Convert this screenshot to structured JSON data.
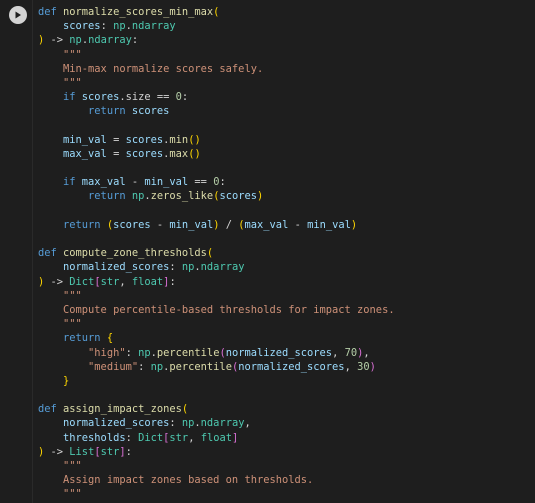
{
  "cell": {
    "run_icon": "play-icon",
    "lines": [
      [
        {
          "t": "def ",
          "c": "kw"
        },
        {
          "t": "normalize_scores_min_max",
          "c": "fn"
        },
        {
          "t": "(",
          "c": "bracket"
        }
      ],
      [
        {
          "t": "    scores",
          "c": "param"
        },
        {
          "t": ": ",
          "c": "op"
        },
        {
          "t": "np",
          "c": "type"
        },
        {
          "t": ".",
          "c": "op"
        },
        {
          "t": "ndarray",
          "c": "type"
        }
      ],
      [
        {
          "t": ")",
          "c": "bracket"
        },
        {
          "t": " -> ",
          "c": "op"
        },
        {
          "t": "np",
          "c": "type"
        },
        {
          "t": ".",
          "c": "op"
        },
        {
          "t": "ndarray",
          "c": "type"
        },
        {
          "t": ":",
          "c": "op"
        }
      ],
      [
        {
          "t": "    \"\"\"",
          "c": "str"
        }
      ],
      [
        {
          "t": "    Min-max normalize scores safely.",
          "c": "str"
        }
      ],
      [
        {
          "t": "    \"\"\"",
          "c": "str"
        }
      ],
      [
        {
          "t": "    if ",
          "c": "kw"
        },
        {
          "t": "scores",
          "c": "param"
        },
        {
          "t": ".size == ",
          "c": "op"
        },
        {
          "t": "0",
          "c": "num"
        },
        {
          "t": ":",
          "c": "op"
        }
      ],
      [
        {
          "t": "        return ",
          "c": "kw"
        },
        {
          "t": "scores",
          "c": "param"
        }
      ],
      [
        {
          "t": "",
          "c": "op"
        }
      ],
      [
        {
          "t": "    min_val",
          "c": "param"
        },
        {
          "t": " = ",
          "c": "op"
        },
        {
          "t": "scores",
          "c": "param"
        },
        {
          "t": ".",
          "c": "op"
        },
        {
          "t": "min",
          "c": "fn"
        },
        {
          "t": "()",
          "c": "bracket"
        }
      ],
      [
        {
          "t": "    max_val",
          "c": "param"
        },
        {
          "t": " = ",
          "c": "op"
        },
        {
          "t": "scores",
          "c": "param"
        },
        {
          "t": ".",
          "c": "op"
        },
        {
          "t": "max",
          "c": "fn"
        },
        {
          "t": "()",
          "c": "bracket"
        }
      ],
      [
        {
          "t": "",
          "c": "op"
        }
      ],
      [
        {
          "t": "    if ",
          "c": "kw"
        },
        {
          "t": "max_val",
          "c": "param"
        },
        {
          "t": " - ",
          "c": "op"
        },
        {
          "t": "min_val",
          "c": "param"
        },
        {
          "t": " == ",
          "c": "op"
        },
        {
          "t": "0",
          "c": "num"
        },
        {
          "t": ":",
          "c": "op"
        }
      ],
      [
        {
          "t": "        return ",
          "c": "kw"
        },
        {
          "t": "np",
          "c": "type"
        },
        {
          "t": ".",
          "c": "op"
        },
        {
          "t": "zeros_like",
          "c": "fn"
        },
        {
          "t": "(",
          "c": "bracket"
        },
        {
          "t": "scores",
          "c": "param"
        },
        {
          "t": ")",
          "c": "bracket"
        }
      ],
      [
        {
          "t": "",
          "c": "op"
        }
      ],
      [
        {
          "t": "    return ",
          "c": "kw"
        },
        {
          "t": "(",
          "c": "bracket"
        },
        {
          "t": "scores",
          "c": "param"
        },
        {
          "t": " - ",
          "c": "op"
        },
        {
          "t": "min_val",
          "c": "param"
        },
        {
          "t": ")",
          "c": "bracket"
        },
        {
          "t": " / ",
          "c": "op"
        },
        {
          "t": "(",
          "c": "bracket"
        },
        {
          "t": "max_val",
          "c": "param"
        },
        {
          "t": " - ",
          "c": "op"
        },
        {
          "t": "min_val",
          "c": "param"
        },
        {
          "t": ")",
          "c": "bracket"
        }
      ],
      [
        {
          "t": "",
          "c": "op"
        }
      ],
      [
        {
          "t": "def ",
          "c": "kw"
        },
        {
          "t": "compute_zone_thresholds",
          "c": "fn"
        },
        {
          "t": "(",
          "c": "bracket"
        }
      ],
      [
        {
          "t": "    normalized_scores",
          "c": "param"
        },
        {
          "t": ": ",
          "c": "op"
        },
        {
          "t": "np",
          "c": "type"
        },
        {
          "t": ".",
          "c": "op"
        },
        {
          "t": "ndarray",
          "c": "type"
        }
      ],
      [
        {
          "t": ")",
          "c": "bracket"
        },
        {
          "t": " -> ",
          "c": "op"
        },
        {
          "t": "Dict",
          "c": "type"
        },
        {
          "t": "[",
          "c": "bracket2"
        },
        {
          "t": "str",
          "c": "type"
        },
        {
          "t": ", ",
          "c": "op"
        },
        {
          "t": "float",
          "c": "type"
        },
        {
          "t": "]",
          "c": "bracket2"
        },
        {
          "t": ":",
          "c": "op"
        }
      ],
      [
        {
          "t": "    \"\"\"",
          "c": "str"
        }
      ],
      [
        {
          "t": "    Compute percentile-based thresholds for impact zones.",
          "c": "str"
        }
      ],
      [
        {
          "t": "    \"\"\"",
          "c": "str"
        }
      ],
      [
        {
          "t": "    return ",
          "c": "kw"
        },
        {
          "t": "{",
          "c": "bracket"
        }
      ],
      [
        {
          "t": "        \"high\"",
          "c": "str"
        },
        {
          "t": ": ",
          "c": "op"
        },
        {
          "t": "np",
          "c": "type"
        },
        {
          "t": ".",
          "c": "op"
        },
        {
          "t": "percentile",
          "c": "fn"
        },
        {
          "t": "(",
          "c": "bracket2"
        },
        {
          "t": "normalized_scores",
          "c": "param"
        },
        {
          "t": ", ",
          "c": "op"
        },
        {
          "t": "70",
          "c": "num"
        },
        {
          "t": ")",
          "c": "bracket2"
        },
        {
          "t": ",",
          "c": "op"
        }
      ],
      [
        {
          "t": "        \"medium\"",
          "c": "str"
        },
        {
          "t": ": ",
          "c": "op"
        },
        {
          "t": "np",
          "c": "type"
        },
        {
          "t": ".",
          "c": "op"
        },
        {
          "t": "percentile",
          "c": "fn"
        },
        {
          "t": "(",
          "c": "bracket2"
        },
        {
          "t": "normalized_scores",
          "c": "param"
        },
        {
          "t": ", ",
          "c": "op"
        },
        {
          "t": "30",
          "c": "num"
        },
        {
          "t": ")",
          "c": "bracket2"
        }
      ],
      [
        {
          "t": "    }",
          "c": "bracket"
        }
      ],
      [
        {
          "t": "",
          "c": "op"
        }
      ],
      [
        {
          "t": "def ",
          "c": "kw"
        },
        {
          "t": "assign_impact_zones",
          "c": "fn"
        },
        {
          "t": "(",
          "c": "bracket"
        }
      ],
      [
        {
          "t": "    normalized_scores",
          "c": "param"
        },
        {
          "t": ": ",
          "c": "op"
        },
        {
          "t": "np",
          "c": "type"
        },
        {
          "t": ".",
          "c": "op"
        },
        {
          "t": "ndarray",
          "c": "type"
        },
        {
          "t": ",",
          "c": "op"
        }
      ],
      [
        {
          "t": "    thresholds",
          "c": "param"
        },
        {
          "t": ": ",
          "c": "op"
        },
        {
          "t": "Dict",
          "c": "type"
        },
        {
          "t": "[",
          "c": "bracket2"
        },
        {
          "t": "str",
          "c": "type"
        },
        {
          "t": ", ",
          "c": "op"
        },
        {
          "t": "float",
          "c": "type"
        },
        {
          "t": "]",
          "c": "bracket2"
        }
      ],
      [
        {
          "t": ")",
          "c": "bracket"
        },
        {
          "t": " -> ",
          "c": "op"
        },
        {
          "t": "List",
          "c": "type"
        },
        {
          "t": "[",
          "c": "bracket2"
        },
        {
          "t": "str",
          "c": "type"
        },
        {
          "t": "]",
          "c": "bracket2"
        },
        {
          "t": ":",
          "c": "op"
        }
      ],
      [
        {
          "t": "    \"\"\"",
          "c": "str"
        }
      ],
      [
        {
          "t": "    Assign impact zones based on thresholds.",
          "c": "str"
        }
      ],
      [
        {
          "t": "    \"\"\"",
          "c": "str"
        }
      ]
    ]
  }
}
